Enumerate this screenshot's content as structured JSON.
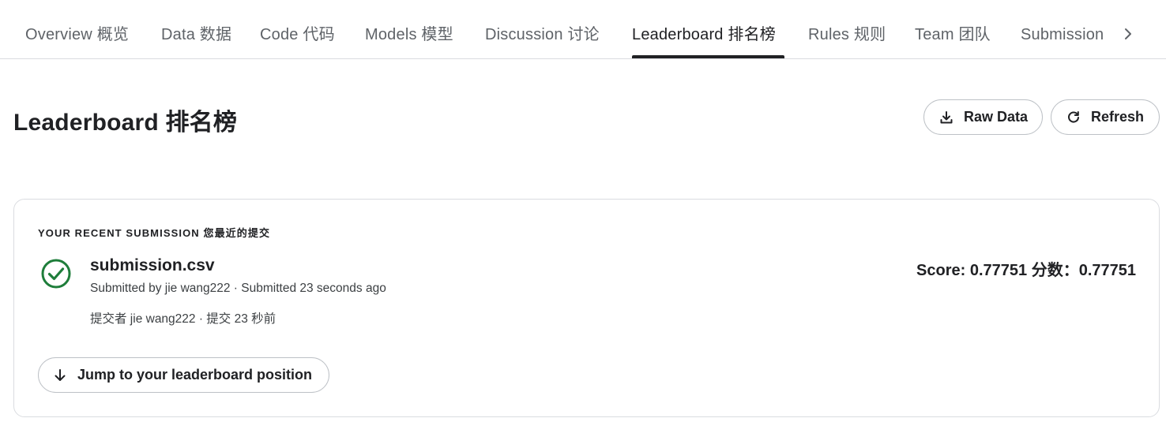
{
  "tabs": [
    {
      "label": "Overview  概览",
      "active": false
    },
    {
      "label": "Data  数据",
      "active": false
    },
    {
      "label": "Code  代码",
      "active": false
    },
    {
      "label": "Models  模型",
      "active": false
    },
    {
      "label": "Discussion  讨论",
      "active": false
    },
    {
      "label": "Leaderboard  排名榜",
      "active": true
    },
    {
      "label": "Rules  规则",
      "active": false
    },
    {
      "label": "Team  团队",
      "active": false
    },
    {
      "label": "Submission",
      "active": false
    }
  ],
  "tab_next_icon": "chevron-right-icon",
  "header": {
    "title": "Leaderboard  排名榜",
    "raw_data_label": "Raw Data",
    "raw_data_icon": "download-icon",
    "refresh_label": "Refresh",
    "refresh_icon": "refresh-icon"
  },
  "submission": {
    "heading": "YOUR RECENT SUBMISSION  您最近的提交",
    "status_icon": "check-circle-icon",
    "status_color": "#1e7d3a",
    "file_name": "submission.csv",
    "meta_en": "Submitted by jie wang222 · Submitted 23 seconds ago",
    "meta_zh": "提交者 jie wang222 · 提交 23 秒前",
    "score": "Score: 0.77751  分数：0.77751",
    "jump_label": "Jump to your leaderboard position",
    "jump_icon": "arrow-down-icon"
  }
}
